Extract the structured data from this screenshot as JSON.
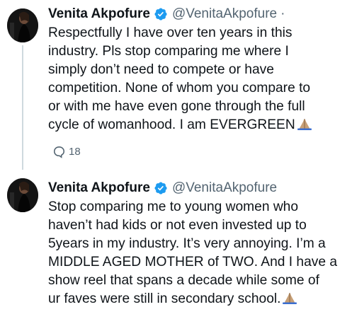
{
  "tweets": [
    {
      "author_name": "Venita Akpofure",
      "handle": "@VenitaAkpofure",
      "separator": "·",
      "lines": [
        "Respectfully I have over ten years in this",
        "industry. Pls stop comparing me where I",
        "simply don’t need to compete or have",
        "competition. None of whom you compare to",
        "or with me have even gone through the full",
        "cycle of womanhood. I am EVERGREEN"
      ],
      "reply_count": "18"
    },
    {
      "author_name": "Venita Akpofure",
      "handle": "@VenitaAkpofure",
      "lines": [
        "Stop comparing me to young women who",
        "haven’t had kids or not even invested up to",
        "5years in my industry. It’s very annoying. I’m a",
        "MIDDLE AGED MOTHER of TWO. And I have a",
        "show reel that spans a decade while some of",
        "ur faves were still in secondary school."
      ]
    }
  ],
  "icons": {
    "verified": "verified-badge-icon",
    "emoji": "folded-hands-icon",
    "reply": "reply-bubble-icon"
  },
  "colors": {
    "text": "#0f1419",
    "secondary": "#536471",
    "verified": "#1d9bf0",
    "thread_line": "#cfd9de"
  }
}
